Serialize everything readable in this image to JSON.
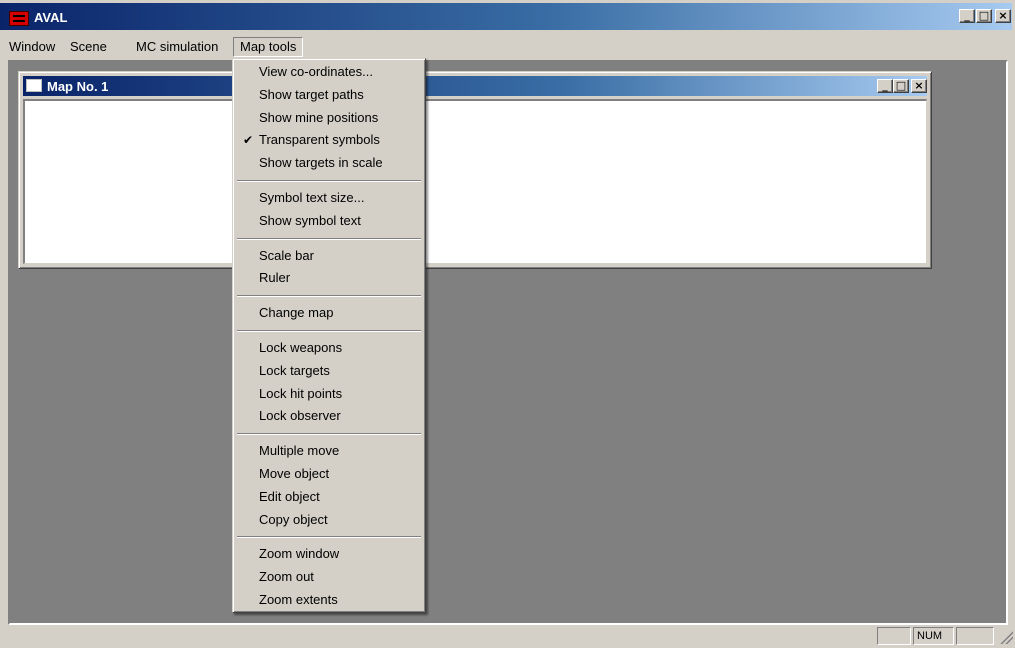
{
  "app": {
    "title": "AVAL"
  },
  "menubar": {
    "items": [
      {
        "label": "Window"
      },
      {
        "label": "Scene"
      },
      {
        "label": "MC simulation"
      },
      {
        "label": "Map tools"
      }
    ]
  },
  "child_window": {
    "title": "Map No. 1"
  },
  "map_tools_menu": {
    "groups": [
      [
        "View co-ordinates...",
        "Show target paths",
        "Show mine positions",
        "Transparent symbols",
        "Show targets in scale"
      ],
      [
        "Symbol text size...",
        "Show symbol text"
      ],
      [
        "Scale bar",
        "Ruler"
      ],
      [
        "Change map"
      ],
      [
        "Lock weapons",
        "Lock targets",
        "Lock hit points",
        "Lock observer"
      ],
      [
        "Multiple move",
        "Move object",
        "Edit object",
        "Copy object"
      ],
      [
        "Zoom window",
        "Zoom out",
        "Zoom extents"
      ]
    ],
    "checked": [
      "Transparent symbols"
    ],
    "check_glyph": "✔"
  },
  "window_controls": {
    "minimize": "_",
    "maximize": "□",
    "close": "×"
  },
  "statusbar": {
    "panes": [
      "",
      "NUM",
      ""
    ]
  }
}
